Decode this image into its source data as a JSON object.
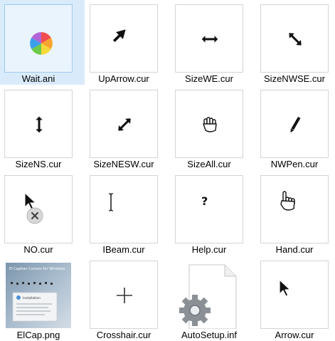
{
  "files": [
    {
      "name": "Wait.ani",
      "icon": "wait-spinner-icon",
      "selected": true
    },
    {
      "name": "UpArrow.cur",
      "icon": "up-arrow-cursor-icon"
    },
    {
      "name": "SizeWE.cur",
      "icon": "size-we-cursor-icon"
    },
    {
      "name": "SizeNWSE.cur",
      "icon": "size-nwse-cursor-icon"
    },
    {
      "name": "SizeNS.cur",
      "icon": "size-ns-cursor-icon"
    },
    {
      "name": "SizeNESW.cur",
      "icon": "size-nesw-cursor-icon"
    },
    {
      "name": "SizeAll.cur",
      "icon": "size-all-hand-cursor-icon"
    },
    {
      "name": "NWPen.cur",
      "icon": "pen-cursor-icon"
    },
    {
      "name": "NO.cur",
      "icon": "no-cursor-icon"
    },
    {
      "name": "IBeam.cur",
      "icon": "ibeam-cursor-icon"
    },
    {
      "name": "Help.cur",
      "icon": "help-cursor-icon"
    },
    {
      "name": "Hand.cur",
      "icon": "hand-cursor-icon"
    },
    {
      "name": "ElCap.png",
      "icon": "image-thumbnail-icon",
      "thumb_text": {
        "title": "El Capitan Cursors for Windows",
        "box_title": "Installation"
      }
    },
    {
      "name": "Crosshair.cur",
      "icon": "crosshair-cursor-icon"
    },
    {
      "name": "AutoSetup.inf",
      "icon": "settings-file-icon"
    },
    {
      "name": "Arrow.cur",
      "icon": "arrow-cursor-icon"
    }
  ],
  "colors": {
    "selection": "#d9ebfb",
    "border": "#d4d4d4"
  }
}
